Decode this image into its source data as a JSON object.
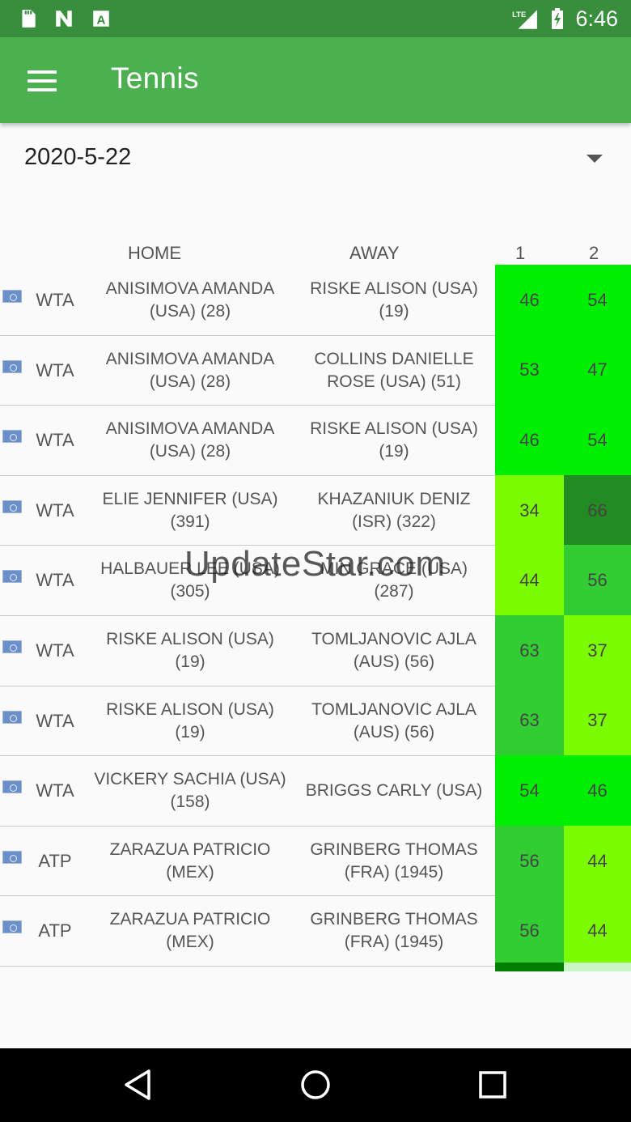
{
  "status_bar": {
    "time": "6:46",
    "icons": [
      "sd-card-icon",
      "n-notification-icon",
      "a-notification-icon",
      "lte-signal-icon",
      "battery-charging-icon"
    ],
    "network_label": "LTE"
  },
  "app_bar": {
    "title": "Tennis",
    "menu_icon": "hamburger-menu-icon"
  },
  "date_selector": {
    "value": "2020-5-22",
    "icon": "dropdown-arrow-icon"
  },
  "table": {
    "headers": {
      "home": "HOME",
      "away": "AWAY",
      "col1": "1",
      "col2": "2"
    },
    "rows": [
      {
        "tour": "WTA",
        "home": "ANISIMOVA AMANDA\n(USA)   (28)",
        "away": "RISKE ALISON (USA)\n(19)",
        "p1": "46",
        "p2": "54",
        "c1": "#00ee00",
        "c2": "#00ee00"
      },
      {
        "tour": "WTA",
        "home": "ANISIMOVA AMANDA\n(USA)   (28)",
        "away": "COLLINS DANIELLE\nROSE (USA)   (51)",
        "p1": "53",
        "p2": "47",
        "c1": "#00ee00",
        "c2": "#00ee00"
      },
      {
        "tour": "WTA",
        "home": "ANISIMOVA AMANDA\n(USA)   (28)",
        "away": "RISKE ALISON (USA)\n(19)",
        "p1": "46",
        "p2": "54",
        "c1": "#00ee00",
        "c2": "#00ee00"
      },
      {
        "tour": "WTA",
        "home": "ELIE JENNIFER (USA)\n(391)",
        "away": "KHAZANIUK DENIZ\n(ISR)   (322)",
        "p1": "34",
        "p2": "66",
        "c1": "#7cfc00",
        "c2": "#228b22"
      },
      {
        "tour": "WTA",
        "home": "HALBAUER LEE (USA)\n(305)",
        "away": "MIN GRACE (USA)\n(287)",
        "p1": "44",
        "p2": "56",
        "c1": "#7cfc00",
        "c2": "#32cd32"
      },
      {
        "tour": "WTA",
        "home": "RISKE ALISON (USA)\n(19)",
        "away": "TOMLJANOVIC AJLA\n(AUS)   (56)",
        "p1": "63",
        "p2": "37",
        "c1": "#32cd32",
        "c2": "#7cfc00"
      },
      {
        "tour": "WTA",
        "home": "RISKE ALISON (USA)\n(19)",
        "away": "TOMLJANOVIC AJLA\n(AUS)   (56)",
        "p1": "63",
        "p2": "37",
        "c1": "#32cd32",
        "c2": "#7cfc00"
      },
      {
        "tour": "WTA",
        "home": "VICKERY SACHIA (USA)\n(158)",
        "away": "BRIGGS CARLY (USA)",
        "p1": "54",
        "p2": "46",
        "c1": "#00ee00",
        "c2": "#00ee00"
      },
      {
        "tour": "ATP",
        "home": "ZARAZUA PATRICIO\n(MEX)",
        "away": "GRINBERG THOMAS\n(FRA)   (1945)",
        "p1": "56",
        "p2": "44",
        "c1": "#32cd32",
        "c2": "#7cfc00"
      },
      {
        "tour": "ATP",
        "home": "ZARAZUA PATRICIO\n(MEX)",
        "away": "GRINBERG THOMAS\n(FRA)   (1945)",
        "p1": "56",
        "p2": "44",
        "c1": "#32cd32",
        "c2": "#7cfc00"
      }
    ],
    "strip_colors": {
      "c1": "#008000",
      "c2": "#c8f7c5"
    }
  },
  "watermark": {
    "text": "UpdateStar.com"
  },
  "nav_bar": {
    "buttons": [
      "back-icon",
      "home-icon",
      "recents-icon"
    ]
  }
}
